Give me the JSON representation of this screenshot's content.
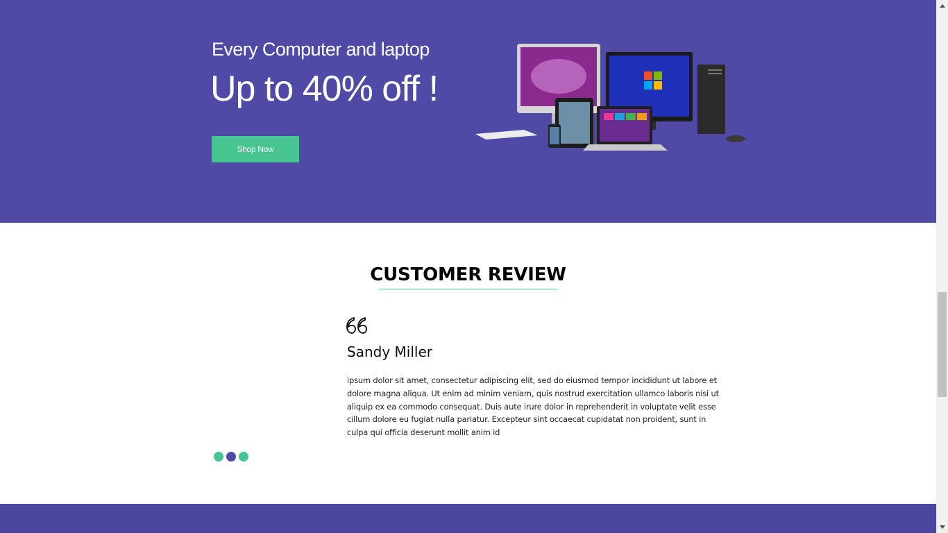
{
  "banner": {
    "subtitle": "Every Computer and laptop",
    "title": "Up to 40% off !",
    "button_label": "Shop Now"
  },
  "review": {
    "heading": "CUSTOMER REVIEW",
    "quote_icon": "quote-icon",
    "name": "Sandy Miller",
    "text": "ipsum dolor sit amet, consectetur adipiscing elit, sed do eiusmod tempor incididunt ut labore et dolore magna aliqua. Ut enim ad minim veniam, quis nostrud exercitation ullamco laboris nisi ut aliquip ex ea commodo consequat. Duis aute irure dolor in reprehenderit in voluptate velit esse cillum dolore eu fugiat nulla pariatur. Excepteur sint occaecat cupidatat non proident, sunt in culpa qui officia deserunt mollit anim id",
    "slides": 3,
    "active_slide": 2
  },
  "colors": {
    "banner_bg": "#4e4aa5",
    "accent_green": "#46c590",
    "dot_active": "#4e4aa5",
    "footer_bg": "#4a469e"
  }
}
